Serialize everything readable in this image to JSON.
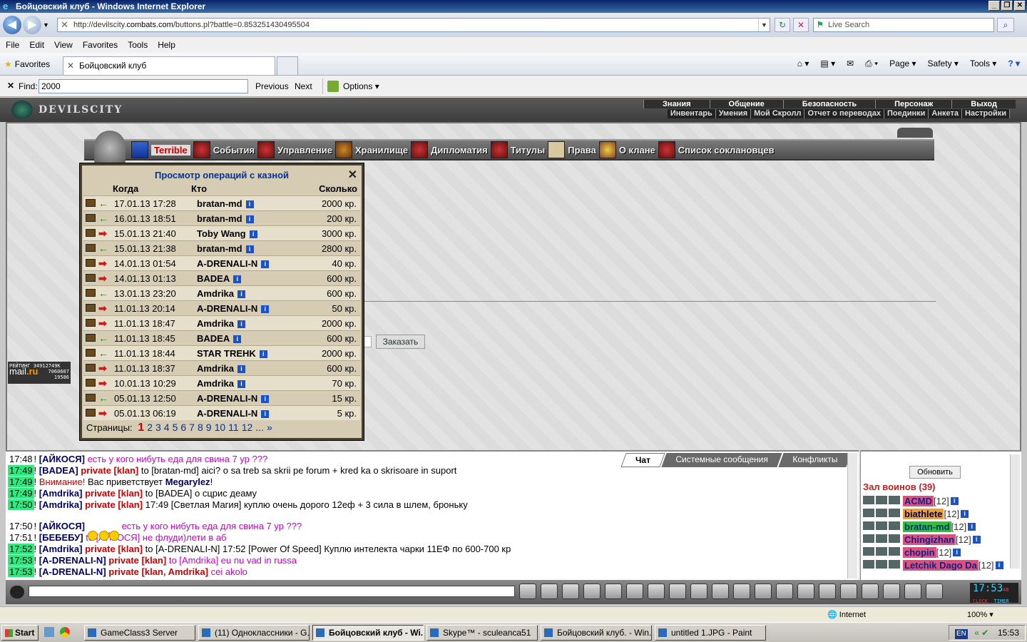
{
  "window": {
    "title": "Бойцовский клуб - Windows Internet Explorer"
  },
  "address": {
    "url_prefix": "http://devilscity.",
    "url_domain": "combats.com",
    "url_suffix": "/buttons.pl?battle=0.853251430495504",
    "search_placeholder": "Live Search"
  },
  "menubar": [
    "File",
    "Edit",
    "View",
    "Favorites",
    "Tools",
    "Help"
  ],
  "favbar": {
    "favorites": "Favorites",
    "tab_title": "Бойцовский клуб",
    "tools": [
      "Page ▾",
      "Safety ▾",
      "Tools ▾",
      "? ▾"
    ]
  },
  "findbar": {
    "label": "Find:",
    "value": "2000",
    "previous": "Previous",
    "next": "Next",
    "options": "Options ▾"
  },
  "site": {
    "logo": "DEVILSCITY",
    "top_menu": [
      "Знания",
      "Общение",
      "Безопасность",
      "Персонаж",
      "Выход"
    ],
    "sub_menu": [
      "Инвентарь",
      "Умения",
      "Мой Скролл",
      "Отчет о переводах",
      "Поединки",
      "Анкета",
      "Настройки"
    ]
  },
  "clan_menu": [
    {
      "label": "Terrible",
      "active": true
    },
    {
      "label": "События"
    },
    {
      "label": "Управление"
    },
    {
      "label": "Хранилище"
    },
    {
      "label": "Дипломатия"
    },
    {
      "label": "Титулы"
    },
    {
      "label": "Права"
    },
    {
      "label": "О клане"
    },
    {
      "label": "Список соклановцев"
    }
  ],
  "order_button": "Заказать",
  "rating": {
    "line1": "РЕЙТИНГ 34912749К",
    "brand": "mail",
    "brand2": ".ru",
    "n1": "7060607",
    "n2": "19586"
  },
  "treasury": {
    "title": "Просмотр операций с казной",
    "close": "✕",
    "columns": {
      "when": "Когда",
      "who": "Кто",
      "amount": "Сколько"
    },
    "rows": [
      {
        "dir": "in",
        "when": "17.01.13 17:28",
        "who": "bratan-md",
        "amount": "2000 кр."
      },
      {
        "dir": "in",
        "when": "16.01.13 18:51",
        "who": "bratan-md",
        "amount": "200 кр."
      },
      {
        "dir": "out",
        "when": "15.01.13 21:40",
        "who": "Toby Wang",
        "amount": "3000 кр."
      },
      {
        "dir": "in",
        "when": "15.01.13 21:38",
        "who": "bratan-md",
        "amount": "2800 кр."
      },
      {
        "dir": "out",
        "when": "14.01.13 01:54",
        "who": "A-DRENALI-N",
        "amount": "40 кр."
      },
      {
        "dir": "out",
        "when": "14.01.13 01:13",
        "who": "BADEA",
        "amount": "600 кр."
      },
      {
        "dir": "in",
        "when": "13.01.13 23:20",
        "who": "Amdrika",
        "amount": "600 кр."
      },
      {
        "dir": "out",
        "when": "11.01.13 20:14",
        "who": "A-DRENALI-N",
        "amount": "50 кр."
      },
      {
        "dir": "out",
        "when": "11.01.13 18:47",
        "who": "Amdrika",
        "amount": "2000 кр."
      },
      {
        "dir": "in",
        "when": "11.01.13 18:45",
        "who": "BADEA",
        "amount": "600 кр."
      },
      {
        "dir": "in",
        "when": "11.01.13 18:44",
        "who": "STAR TREHK",
        "amount": "2000 кр."
      },
      {
        "dir": "out",
        "when": "11.01.13 18:37",
        "who": "Amdrika",
        "amount": "600 кр."
      },
      {
        "dir": "out",
        "when": "10.01.13 10:29",
        "who": "Amdrika",
        "amount": "70 кр."
      },
      {
        "dir": "in",
        "when": "05.01.13 12:50",
        "who": "A-DRENALI-N",
        "amount": "15 кр."
      },
      {
        "dir": "out",
        "when": "05.01.13 06:19",
        "who": "A-DRENALI-N",
        "amount": "5 кр."
      }
    ],
    "pages_label": "Страницы:",
    "pages": [
      "1",
      "2",
      "3",
      "4",
      "5",
      "6",
      "7",
      "8",
      "9",
      "10",
      "11",
      "12",
      "...",
      "»"
    ]
  },
  "chat": {
    "tabs": [
      "Чат",
      "Системные сообщения",
      "Конфликты"
    ],
    "lines": [
      {
        "time": "17:48",
        "hl": false,
        "nick": "[АЙКОСЯ]",
        "tag": "",
        "text": "есть у кого нибуть еда для свина 7 ур ???",
        "style": "mg"
      },
      {
        "time": "17:49",
        "hl": true,
        "nick": "[BADEA]",
        "tag": "private [klan]",
        "text": "to [bratan-md] aici? o sa treb sa skrii pe forum + kred ka o skrisoare in suport",
        "style": ""
      },
      {
        "time": "17:49",
        "hl": true,
        "nick": "",
        "tag": "",
        "warn": "Внимание!",
        "text": "Вас приветствует",
        "bold": "Megarylez",
        "tail": "!",
        "style": ""
      },
      {
        "time": "17:49",
        "hl": true,
        "nick": "[Amdrika]",
        "tag": "private [klan]",
        "text": "to [BADEA] о сцрис деаму",
        "style": ""
      },
      {
        "time": "17:50",
        "hl": true,
        "nick": "[Amdrika]",
        "tag": "private [klan]",
        "text": "17:49 [Светлая Магия] куплю очень дорого 12еф + 3 сила в шлем, броньку",
        "style": ""
      },
      {
        "time": "17:50",
        "hl": false,
        "nick": "[АЙКОСЯ]",
        "tag": "",
        "text": "есть у кого нибуть еда для свина 7 ур ???",
        "style": "mg",
        "smileys": true
      },
      {
        "time": "17:51",
        "hl": false,
        "nick": "[БЕБЕБУ]",
        "tag": "",
        "text": "to [АЙКОСЯ] не флуди)лети в аб",
        "style": "mg"
      },
      {
        "time": "17:52",
        "hl": true,
        "nick": "[Amdrika]",
        "tag": "private [klan]",
        "text": "to [A-DRENALI-N] 17:52 [Power Of Speed] Куплю интелекта чарки 11ЕФ по 600-700 кр",
        "style": ""
      },
      {
        "time": "17:53",
        "hl": true,
        "nick": "[A-DRENALI-N]",
        "tag": "private [klan]",
        "text": "to [Amdrika] eu nu vad in russa",
        "style": "mg"
      },
      {
        "time": "17:53",
        "hl": true,
        "nick": "[A-DRENALI-N]",
        "tag": "private [klan, Amdrika]",
        "text": "cei akolo",
        "style": "mg"
      }
    ]
  },
  "side": {
    "refresh": "Обновить",
    "hall": "Зал воинов (39)",
    "users": [
      {
        "name": "ACMD",
        "level": "[12]",
        "bg": "#e84a7a",
        "color": "#002a8a"
      },
      {
        "name": "biathlete",
        "level": "[12]",
        "bg": "#f0a030",
        "color": "#000055"
      },
      {
        "name": "bratan-md",
        "level": "[12]",
        "bg": "#30c030",
        "color": "#002a8a"
      },
      {
        "name": "Chingizhan",
        "level": "[12]",
        "bg": "#e84a7a",
        "color": "#002a8a"
      },
      {
        "name": "chopin",
        "level": "[12]",
        "bg": "#e84a7a",
        "color": "#002a8a"
      },
      {
        "name": "Letchik Dago Da",
        "level": "[12]",
        "bg": "#e84a7a",
        "color": "#002a8a"
      }
    ]
  },
  "clock": {
    "time": "17:53",
    "sec": "48",
    "l1": "CLOCK",
    "l2": "TIMER"
  },
  "status": {
    "zone": "Internet",
    "zoom": "100% ▾"
  },
  "taskbar": {
    "start": "Start",
    "tasks": [
      {
        "label": "GameClass3 Server",
        "w": 156
      },
      {
        "label": "(11) Одноклассники - G...",
        "w": 156
      },
      {
        "label": "Бойцовский клуб - Wi...",
        "w": 156,
        "active": true
      },
      {
        "label": "Skype™ - sculeanca51",
        "w": 156
      },
      {
        "label": "Бойцовский клуб. - Win...",
        "w": 156
      },
      {
        "label": "untitled 1.JPG - Paint",
        "w": 156
      }
    ],
    "lang": "EN",
    "time": "15:53"
  }
}
